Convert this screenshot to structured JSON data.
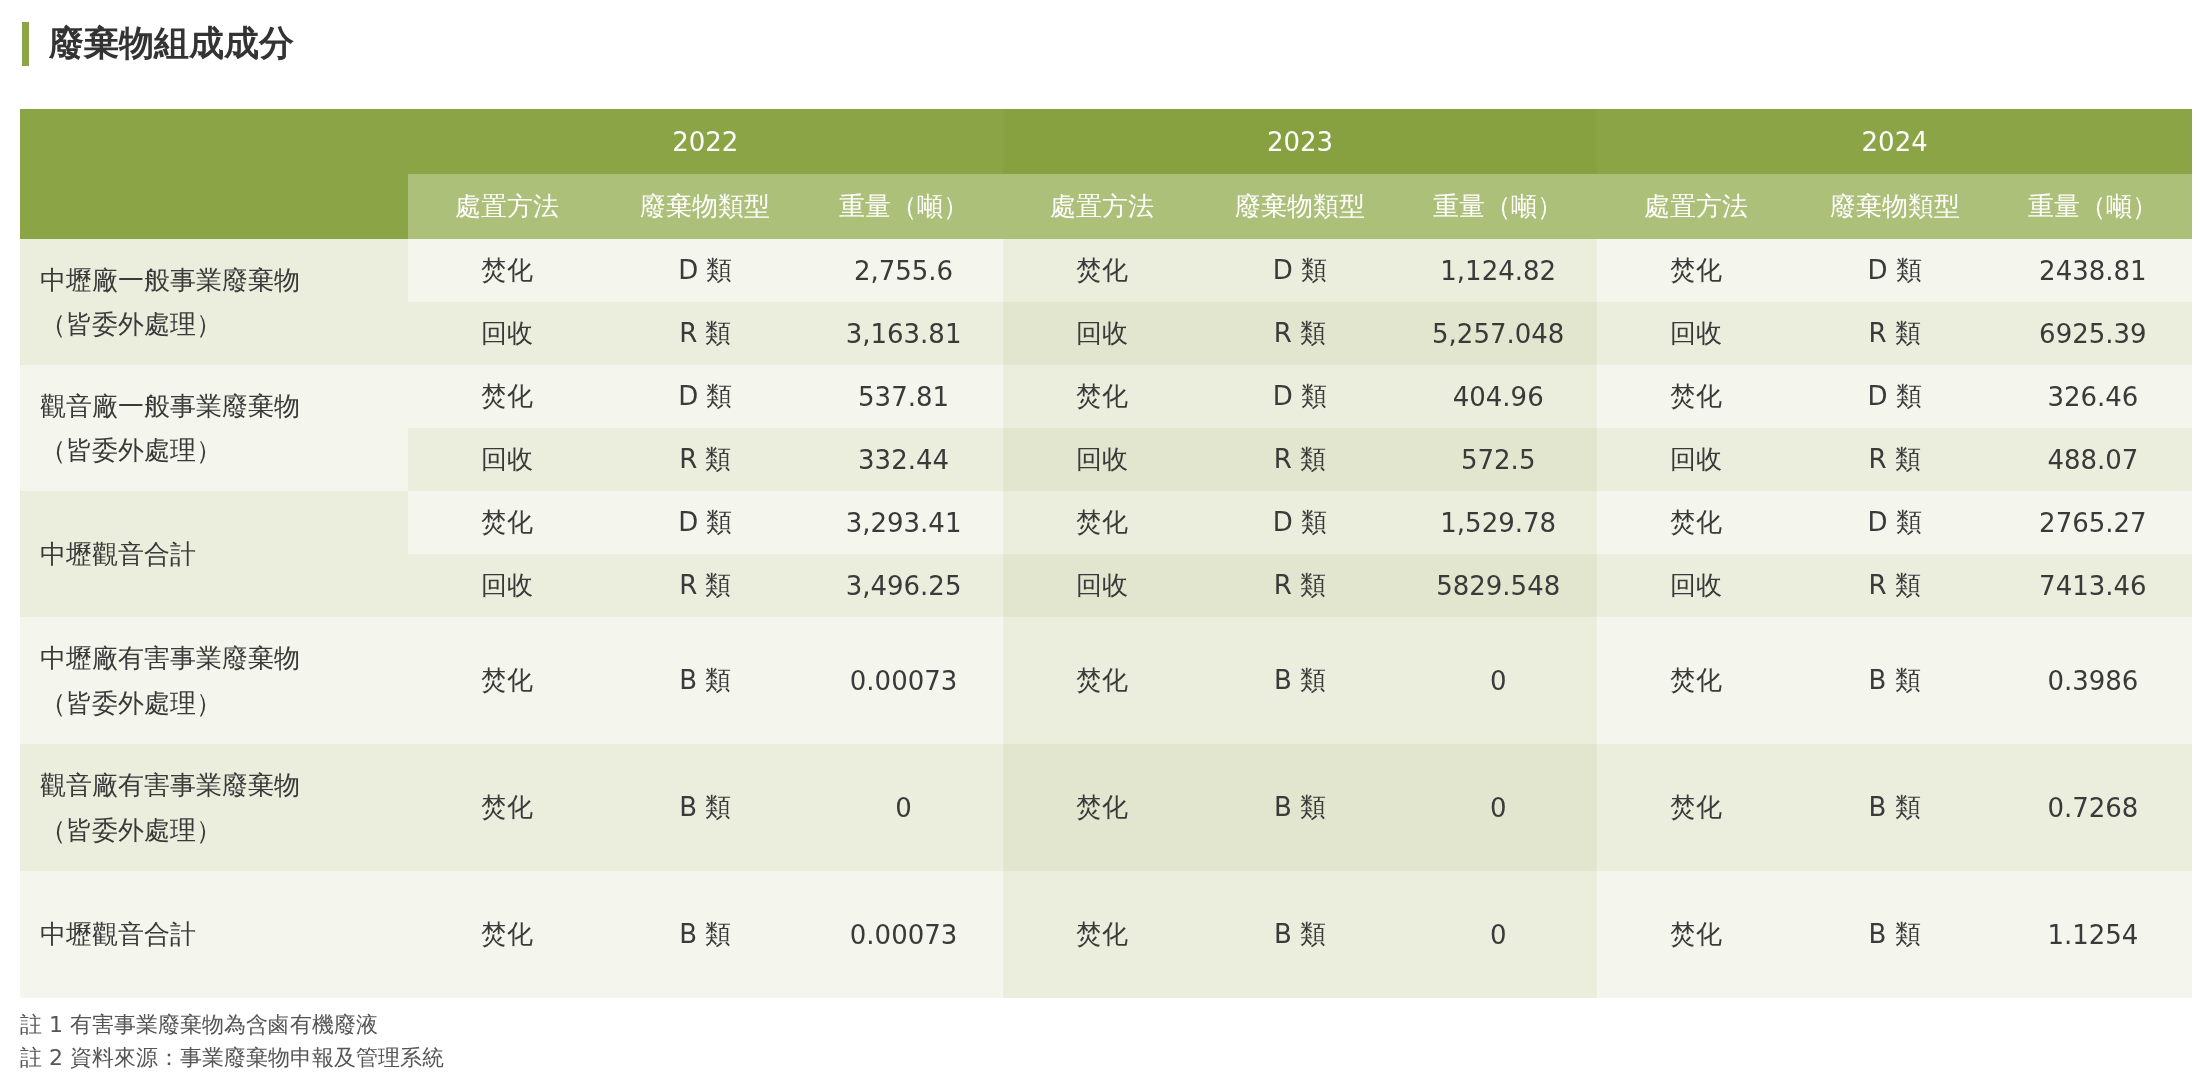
{
  "title": "廢棄物組成成分",
  "table": {
    "years": [
      {
        "year": "2022",
        "columns": [
          "處置方法",
          "廢棄物類型",
          "重量（噸）"
        ]
      },
      {
        "year": "2023",
        "columns": [
          "處置方法",
          "廢棄物類型",
          "重量（噸）"
        ]
      },
      {
        "year": "2024",
        "columns": [
          "處置方法",
          "廢棄物類型",
          "重量（噸）"
        ]
      }
    ],
    "groups": [
      {
        "kind": "general",
        "label": "中壢廠一般事業廢棄物（皆委外處理）",
        "rows": [
          [
            [
              "焚化",
              "D 類",
              "2,755.6"
            ],
            [
              "焚化",
              "D 類",
              "1,124.82"
            ],
            [
              "焚化",
              "D 類",
              "2438.81"
            ]
          ],
          [
            [
              "回收",
              "R 類",
              "3,163.81"
            ],
            [
              "回收",
              "R 類",
              "5,257.048"
            ],
            [
              "回收",
              "R 類",
              "6925.39"
            ]
          ]
        ]
      },
      {
        "kind": "general",
        "label": "觀音廠一般事業廢棄物（皆委外處理）",
        "rows": [
          [
            [
              "焚化",
              "D 類",
              "537.81"
            ],
            [
              "焚化",
              "D 類",
              "404.96"
            ],
            [
              "焚化",
              "D 類",
              "326.46"
            ]
          ],
          [
            [
              "回收",
              "R 類",
              "332.44"
            ],
            [
              "回收",
              "R 類",
              "572.5"
            ],
            [
              "回收",
              "R 類",
              "488.07"
            ]
          ]
        ]
      },
      {
        "kind": "general",
        "label": "中壢觀音合計",
        "rows": [
          [
            [
              "焚化",
              "D 類",
              "3,293.41"
            ],
            [
              "焚化",
              "D 類",
              "1,529.78"
            ],
            [
              "焚化",
              "D 類",
              "2765.27"
            ]
          ],
          [
            [
              "回收",
              "R 類",
              "3,496.25"
            ],
            [
              "回收",
              "R 類",
              "5829.548"
            ],
            [
              "回收",
              "R 類",
              "7413.46"
            ]
          ]
        ]
      },
      {
        "kind": "hazardous",
        "label": "中壢廠有害事業廢棄物（皆委外處理）",
        "rows": [
          [
            [
              "焚化",
              "B 類",
              "0.00073"
            ],
            [
              "焚化",
              "B 類",
              "0"
            ],
            [
              "焚化",
              "B 類",
              "0.3986"
            ]
          ]
        ]
      },
      {
        "kind": "hazardous",
        "label": "觀音廠有害事業廢棄物（皆委外處理）",
        "rows": [
          [
            [
              "焚化",
              "B 類",
              "0"
            ],
            [
              "焚化",
              "B 類",
              "0"
            ],
            [
              "焚化",
              "B 類",
              "0.7268"
            ]
          ]
        ]
      },
      {
        "kind": "hazardous",
        "label": "中壢觀音合計",
        "rows": [
          [
            [
              "焚化",
              "B 類",
              "0.00073"
            ],
            [
              "焚化",
              "B 類",
              "0"
            ],
            [
              "焚化",
              "B 類",
              "1.1254"
            ]
          ]
        ]
      }
    ]
  },
  "notes": [
    "註 1 有害事業廢棄物為含鹵有機廢液",
    "註 2 資料來源：事業廢棄物申報及管理系統"
  ]
}
